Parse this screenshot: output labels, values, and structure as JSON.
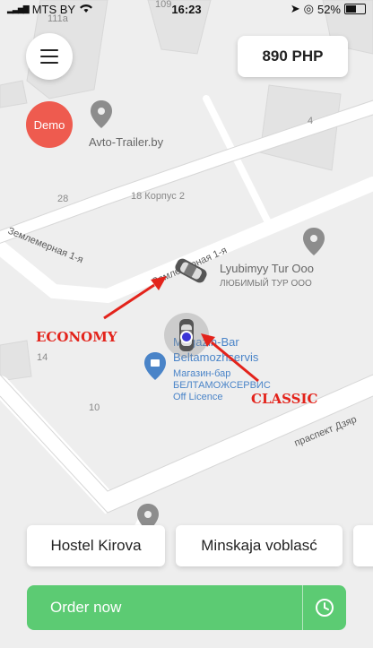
{
  "status_bar": {
    "carrier": "MTS BY",
    "time": "16:23",
    "battery": "52%",
    "battery_level": 0.52
  },
  "header": {
    "price_label": "890 PHP",
    "demo_label": "Demo"
  },
  "map": {
    "pois": [
      {
        "name": "Avto-Trailer.by"
      },
      {
        "name": "Lyubimyy Tur Ooo",
        "subtitle": "ЛЮБИМЫЙ ТУР ООО"
      },
      {
        "name": "Magazin-Bar Beltamozhservis",
        "subtitle_line1": "Магазин-бар",
        "subtitle_line2": "БЕЛТАМОЖСЕРВИС",
        "subtitle_line3": "Off Licence"
      }
    ],
    "street_labels": [
      "Землемерная 1-я",
      "Землемерная 1-я",
      "праспект Дзяр"
    ],
    "building_numbers": [
      "111a",
      "109",
      "4",
      "28",
      "18 Корпус 2",
      "14",
      "10"
    ]
  },
  "annotations": {
    "economy": "ECONOMY",
    "classic": "CLASSIC"
  },
  "destinations": [
    "Hostel Kirova",
    "Minskaja voblasć"
  ],
  "order": {
    "label": "Order now"
  },
  "colors": {
    "accent_green": "#5ccb73",
    "demo_red": "#ee5b4f",
    "annotation_red": "#e3231b",
    "poi_blue": "#4a84c8"
  }
}
